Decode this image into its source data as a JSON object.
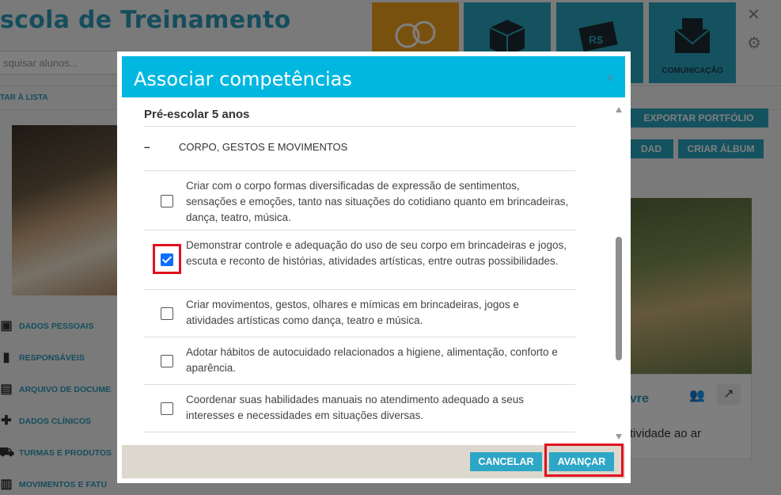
{
  "app": {
    "title": "scola de Treinamento",
    "search_placeholder": "squisar alunos...",
    "back_link": "TAR À LISTA",
    "tiles": [
      {
        "icon": "children-icon",
        "label": ""
      },
      {
        "icon": "box-icon",
        "label": ""
      },
      {
        "icon": "money-icon",
        "label": ""
      },
      {
        "icon": "mail-icon",
        "label": "COMUNICAÇÃO"
      }
    ],
    "side_menu": [
      {
        "icon": "person-card-icon",
        "label": "DADOS PESSOAIS"
      },
      {
        "icon": "document-icon",
        "label": "RESPONSÁVEIS"
      },
      {
        "icon": "archive-icon",
        "label": "ARQUIVO DE DOCUME"
      },
      {
        "icon": "medical-icon",
        "label": "DADOS CLÍNICOS"
      },
      {
        "icon": "cart-icon",
        "label": "TURMAS E PRODUTOS"
      },
      {
        "icon": "money-icon",
        "label": "MOVIMENTOS E FATU"
      }
    ],
    "buttons": {
      "export": "EXPORTAR PORTFÓLIO",
      "activity": "DAD",
      "album": "CRIAR ÁLBUM"
    },
    "card": {
      "title": "vre",
      "description": "tividade ao ar"
    }
  },
  "modal": {
    "title": "Associar competências",
    "close_label": "x",
    "group_title": "Pré-escolar 5 anos",
    "subgroup": {
      "toggle": "–",
      "label": "CORPO, GESTOS E MOVIMENTOS"
    },
    "items": [
      {
        "text": "Criar com o corpo formas diversificadas de expressão de sentimentos, sensações e emoções, tanto nas situações do cotidiano quanto em brincadeiras, dança, teatro, música.",
        "checked": false
      },
      {
        "text": "Demonstrar controle e adequação do uso de seu corpo em brincadeiras e jogos, escuta e reconto de histórias, atividades artísticas, entre outras possibilidades.",
        "checked": true
      },
      {
        "text": "Criar movimentos, gestos, olhares e mímicas em brincadeiras, jogos e atividades artísticas como dança, teatro e música.",
        "checked": false
      },
      {
        "text": "Adotar hábitos de autocuidado relacionados a higiene, alimentação, conforto e aparência.",
        "checked": false
      },
      {
        "text": "Coordenar suas habilidades manuais no atendimento adequado a seus interesses e necessidades em situações diversas.",
        "checked": false
      }
    ],
    "footer": {
      "cancel_label": "CANCELAR",
      "next_label": "AVANÇAR"
    }
  },
  "colors": {
    "header": "#00b7e0",
    "button": "#2ea7c6",
    "highlight": "#e01020",
    "footer": "#ddd8cd"
  }
}
